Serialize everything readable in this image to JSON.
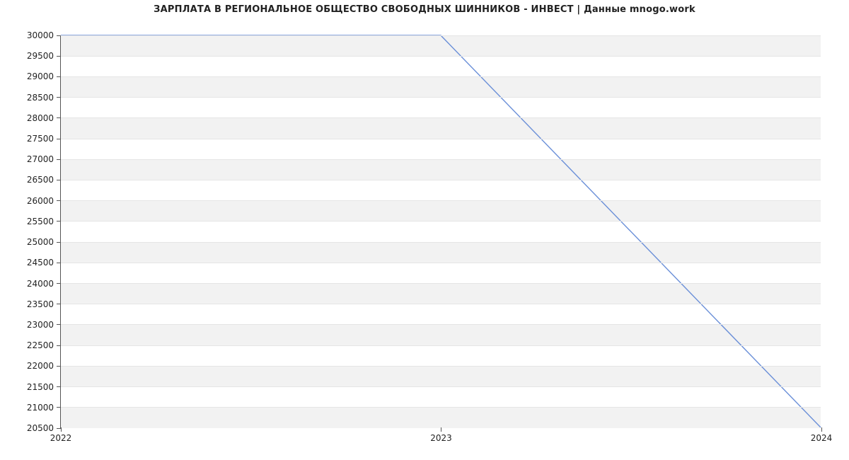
{
  "chart_data": {
    "type": "line",
    "title": "ЗАРПЛАТА В  РЕГИОНАЛЬНОЕ ОБЩЕСТВО СВОБОДНЫХ ШИННИКОВ - ИНВЕСТ | Данные mnogo.work",
    "xlabel": "",
    "ylabel": "",
    "x": [
      2022,
      2023,
      2024
    ],
    "values": [
      30000,
      30000,
      20500
    ],
    "xticks": [
      2022,
      2023,
      2024
    ],
    "yticks": [
      20500,
      21000,
      21500,
      22000,
      22500,
      23000,
      23500,
      24000,
      24500,
      25000,
      25500,
      26000,
      26500,
      27000,
      27500,
      28000,
      28500,
      29000,
      29500,
      30000
    ],
    "xlim": [
      2022,
      2024
    ],
    "ylim": [
      20500,
      30000
    ],
    "grid": true,
    "grid_bands": true,
    "line_color": "#6a8fd8"
  }
}
